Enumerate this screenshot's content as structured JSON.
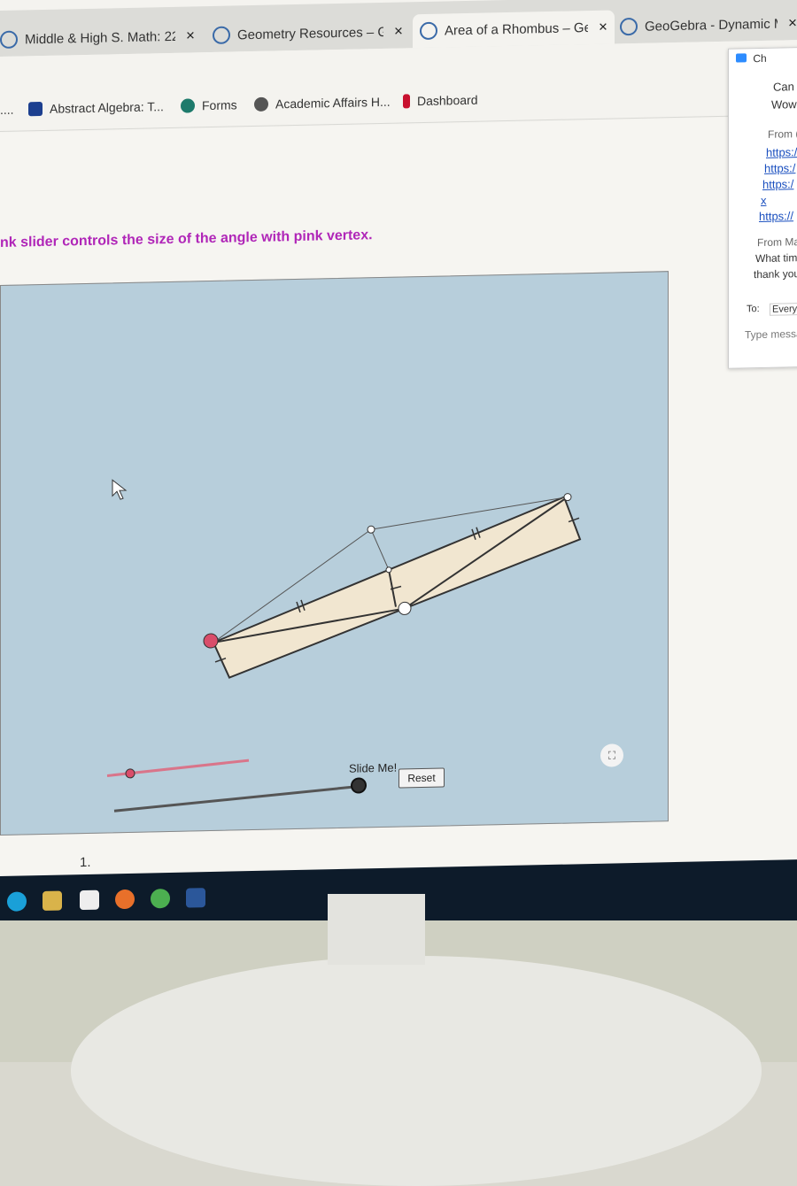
{
  "tabs": [
    {
      "label": "Middle & High S. Math: 22",
      "close": "×"
    },
    {
      "label": "Geometry Resources – Geo",
      "close": "×"
    },
    {
      "label": "Area of a Rhombus – GeoG",
      "close": "×"
    },
    {
      "label": "GeoGebra - Dynamic Math",
      "close": "×"
    }
  ],
  "bookmarks": [
    {
      "label": "...."
    },
    {
      "label": "Abstract Algebra: T..."
    },
    {
      "label": "Forms"
    },
    {
      "label": "Academic Affairs H..."
    },
    {
      "label": "Dashboard"
    }
  ],
  "instruction": "nk slider controls the size of the angle with pink vertex.",
  "applet": {
    "slide_label": "Slide Me!",
    "reset_label": "Reset",
    "fullscreen_icon": "⛶"
  },
  "question_number": "1.",
  "chat": {
    "title": "Ch",
    "lines": [
      "Can",
      "Wow"
    ],
    "from1": "From (",
    "links": [
      "https:/",
      "https:/",
      "https:/",
      "x",
      "https://"
    ],
    "from2": "From Mar",
    "msg2": [
      "What tim",
      "thank you"
    ],
    "to_label": "To:",
    "to_value": "Everyo",
    "placeholder": "Type messa"
  },
  "colors": {
    "instruction": "#b026b8",
    "applet_bg": "#b7cedb",
    "rhombus_fill": "#f1e6d0",
    "pink_vertex": "#d94d6a"
  }
}
